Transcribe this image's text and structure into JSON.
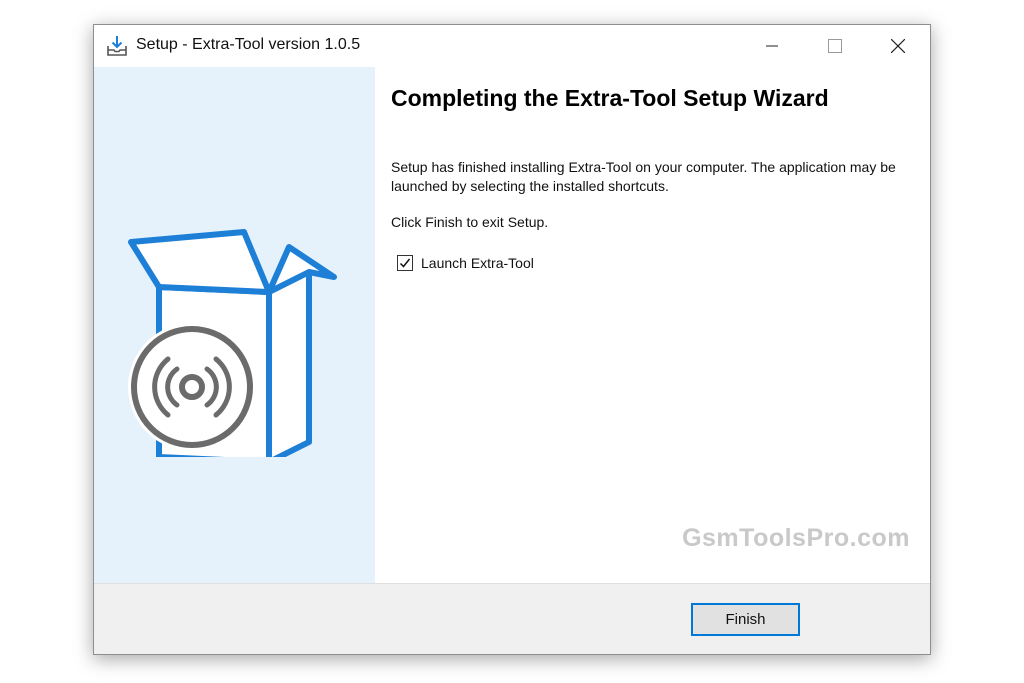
{
  "window": {
    "title": "Setup - Extra-Tool version 1.0.5",
    "icons": [
      "installer-icon",
      "minimize-icon",
      "maximize-icon",
      "close-icon"
    ]
  },
  "content": {
    "heading": "Completing the Extra-Tool Setup Wizard",
    "description": "Setup has finished installing Extra-Tool on your computer. The application may be launched by selecting the installed shortcuts.",
    "exit_text": "Click Finish to exit Setup.",
    "launch_label": "Launch Extra-Tool",
    "launch_checked": true,
    "watermark": "GsmToolsPro.com"
  },
  "footer": {
    "finish_label": "Finish"
  },
  "colors": {
    "accent": "#0078d7",
    "panel": "#e5f2fc",
    "disc": "#6b6b6b",
    "box": "#1e7fd6"
  }
}
